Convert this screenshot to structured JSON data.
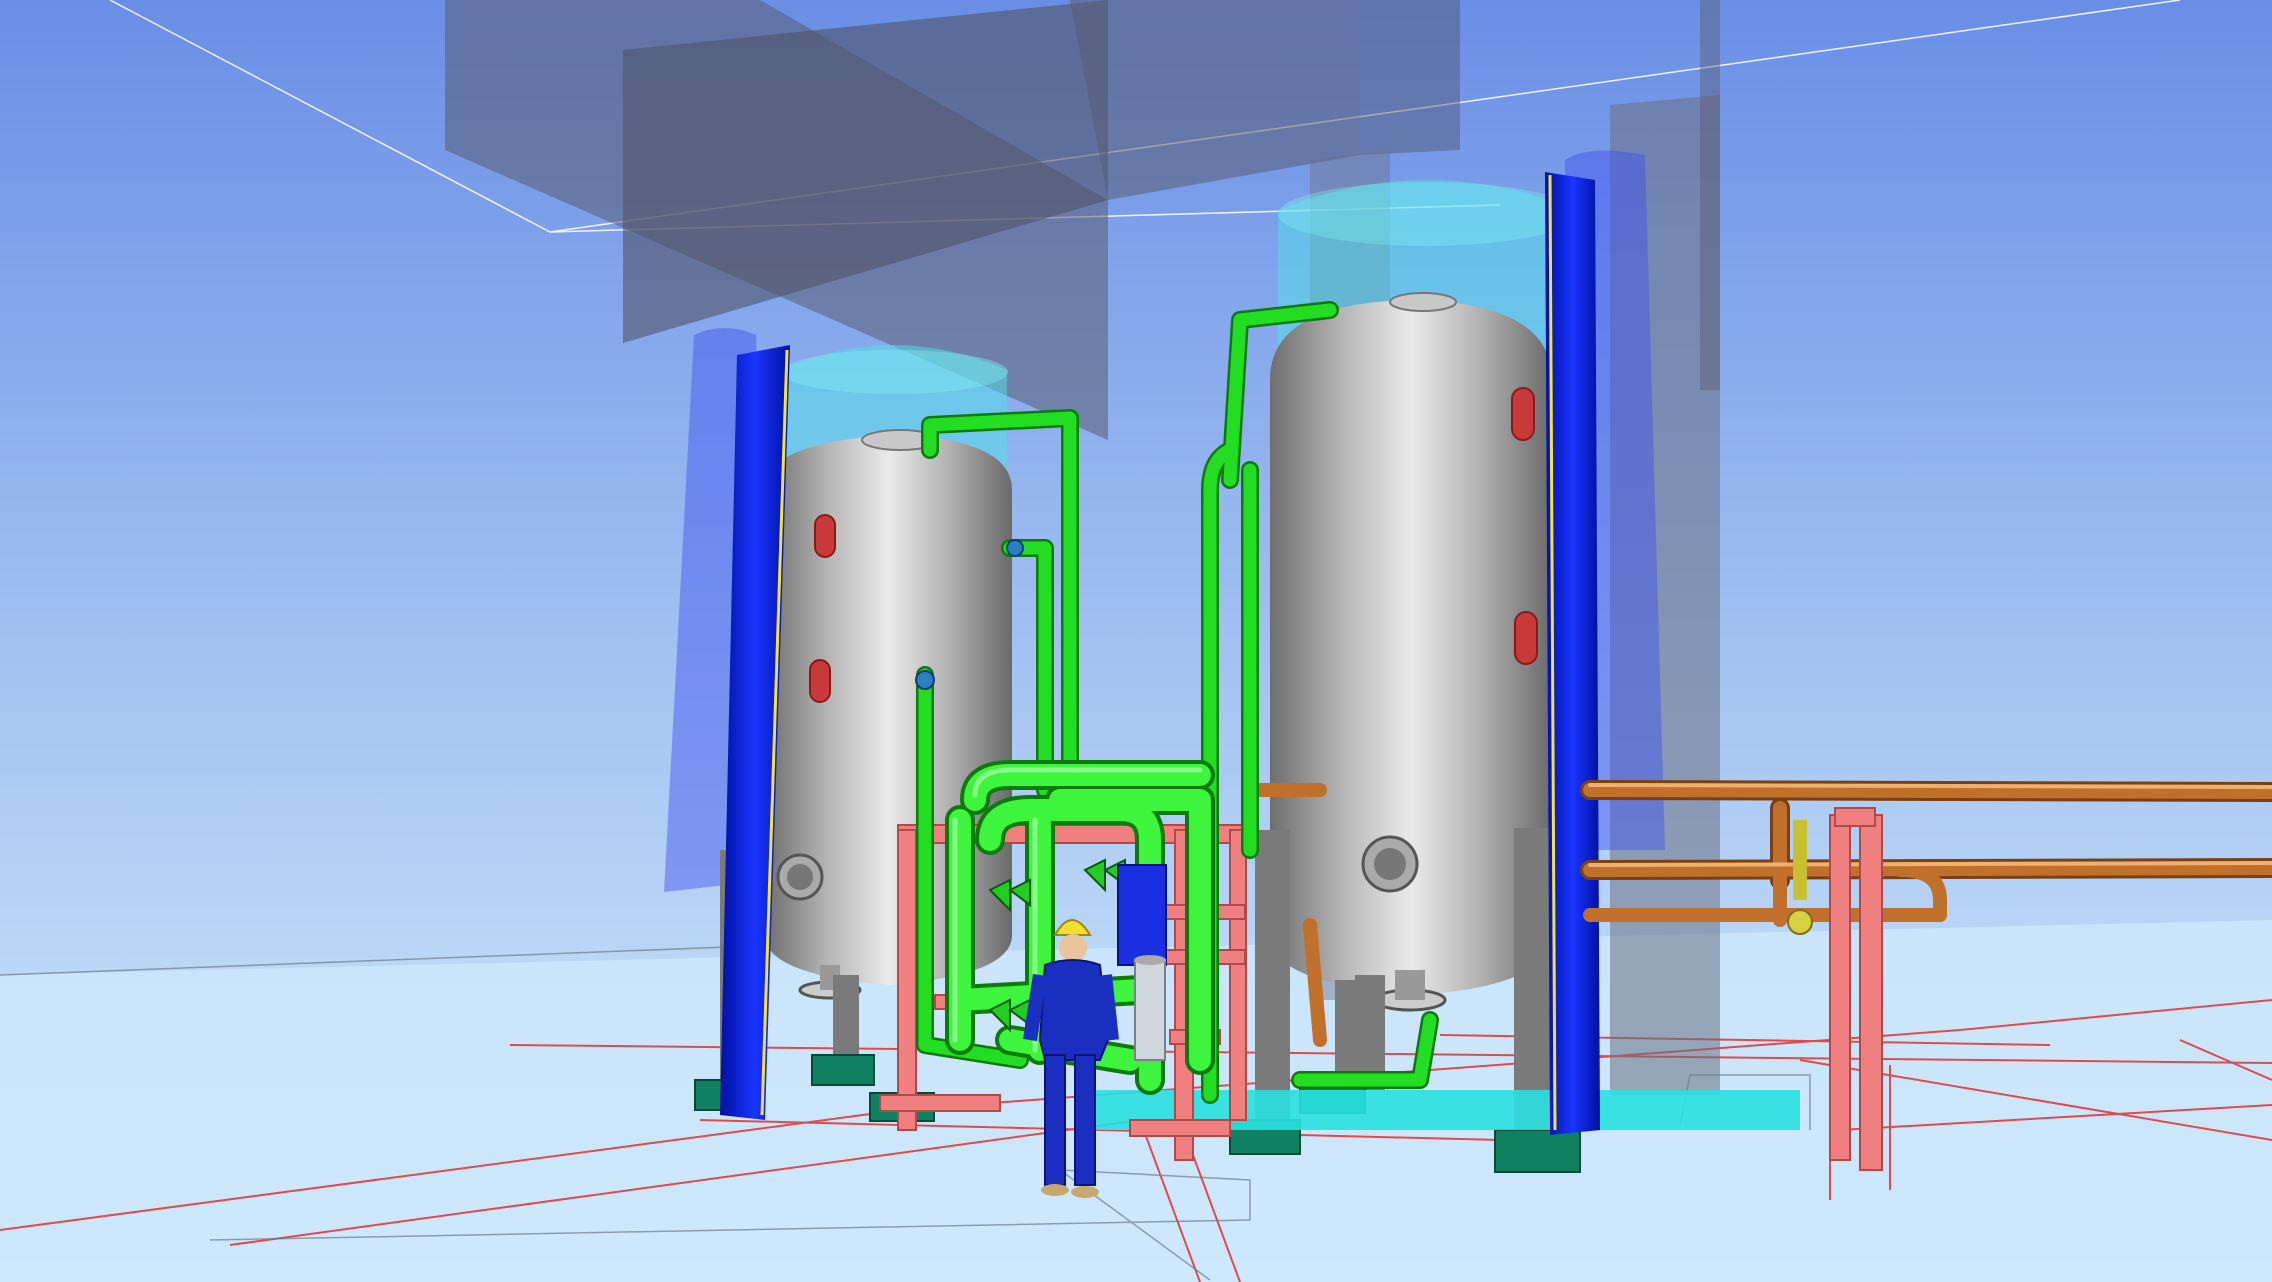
{
  "scene": {
    "kind": "3d-plant-model-viewport",
    "colors": {
      "sky_top": "#6b8fe6",
      "sky_bottom": "#c8e6fb",
      "floor": "#cfe9fb",
      "vessel": "#9a9a9a",
      "vessel_highlight": "#e6e6e6",
      "pipe_green": "#22dd22",
      "pipe_green_dark": "#118811",
      "pipe_copper": "#c0702a",
      "frame_pink": "#f08080",
      "ladder_blue": "#0a1fd0",
      "translucent_blue": "#3f4ff0",
      "translucent_cyan": "#4fe0e8",
      "concrete_grey": "#6d7380",
      "base_teal": "#0f8060",
      "grid_red": "#e03030",
      "worker_blue": "#1a2fc0",
      "helmet_yellow": "#f2dd30"
    }
  }
}
